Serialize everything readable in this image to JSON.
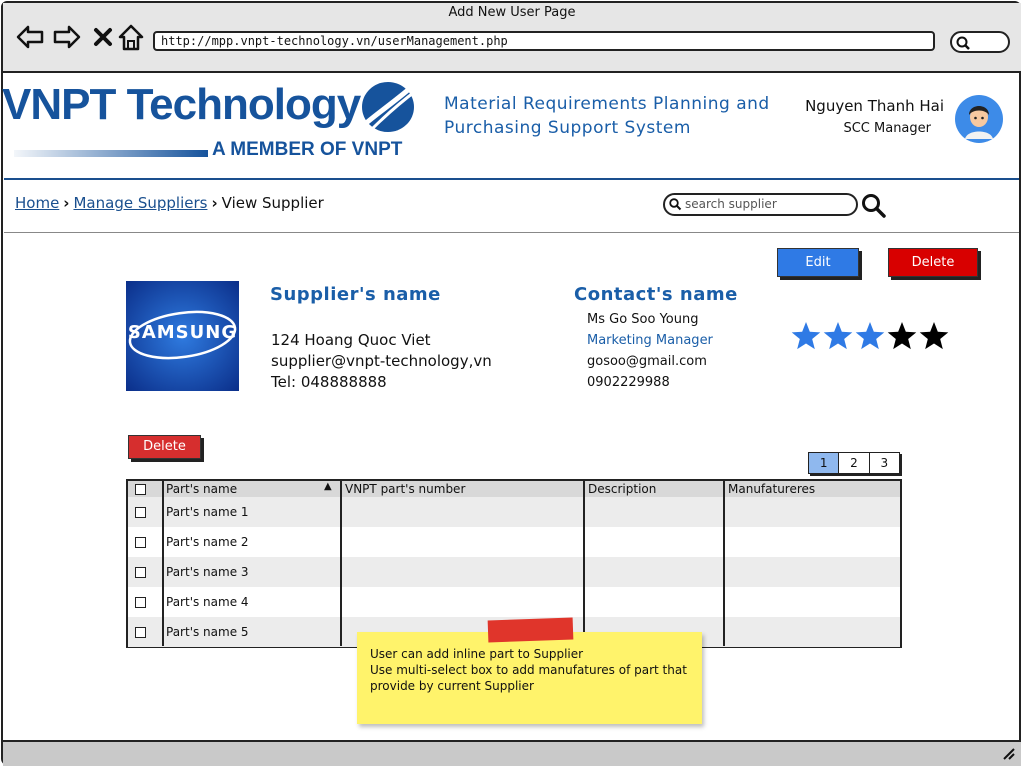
{
  "browser": {
    "window_title": "Add New User Page",
    "url": "http://mpp.vnpt-technology.vn/userManagement.php"
  },
  "header": {
    "logo_text": "VNPT Technology",
    "logo_subtext": "A MEMBER OF VNPT",
    "system_title": "Material Requirements Planning and Purchasing Support System",
    "user_name": "Nguyen Thanh Hai",
    "user_role": "SCC Manager"
  },
  "breadcrumb": {
    "home": "Home",
    "manage_suppliers": "Manage Suppliers",
    "current": "View Supplier"
  },
  "search": {
    "placeholder": "search supplier"
  },
  "actions": {
    "edit": "Edit",
    "delete": "Delete"
  },
  "supplier": {
    "logo_text": "SAMSUNG",
    "name_label": "Supplier's name",
    "address": "124 Hoang Quoc Viet",
    "email": "supplier@vnpt-technology,vn",
    "phone": "Tel: 048888888"
  },
  "contact": {
    "name_label": "Contact's name",
    "person": "Ms Go Soo Young",
    "title": "Marketing Manager",
    "email": "gosoo@gmail.com",
    "phone": "0902229988"
  },
  "rating": {
    "value": 3,
    "max": 5,
    "filled_color": "#2f7ae5",
    "empty_color": "#000000"
  },
  "table": {
    "delete_label": "Delete",
    "pages": [
      "1",
      "2",
      "3"
    ],
    "current_page": "1",
    "columns": [
      "Part's name",
      "VNPT part's number",
      "Description",
      "Manufatureres"
    ],
    "rows": [
      "Part's name 1",
      "Part's name 2",
      "Part's name 3",
      "Part's name 4",
      "Part's name 5"
    ]
  },
  "note": {
    "line1": "User can add inline part to Supplier",
    "line2": "Use multi-select box to add manufatures of part that provide by current Supplier"
  },
  "colors": {
    "brand_blue": "#16539c",
    "edit_blue": "#2f7ae5",
    "delete_red": "#d80000",
    "sticky_yellow": "#fff36b"
  }
}
